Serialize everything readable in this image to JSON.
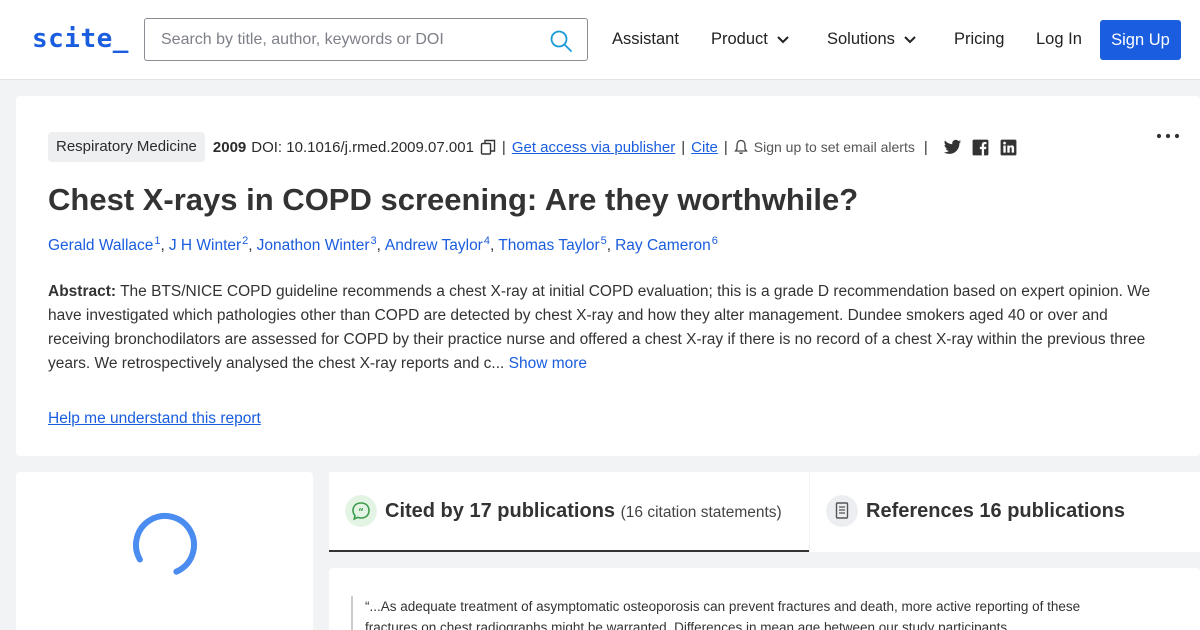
{
  "header": {
    "logo": "scite_",
    "search_placeholder": "Search by title, author, keywords or DOI",
    "nav": {
      "assistant": "Assistant",
      "product": "Product",
      "solutions": "Solutions",
      "pricing": "Pricing",
      "login": "Log In",
      "signup": "Sign Up"
    },
    "accent_color": "#1a5dde"
  },
  "paper": {
    "journal": "Respiratory Medicine",
    "year": "2009",
    "doi": "DOI: 10.1016/j.rmed.2009.07.001",
    "access_link": "Get access via publisher",
    "cite_link": "Cite",
    "alerts": "Sign up to set email alerts",
    "title": "Chest X-rays in COPD screening: Are they worthwhile?",
    "authors": [
      {
        "name": "Gerald Wallace",
        "sup": "1"
      },
      {
        "name": "J H Winter",
        "sup": "2"
      },
      {
        "name": "Jonathon Winter",
        "sup": "3"
      },
      {
        "name": "Andrew Taylor",
        "sup": "4"
      },
      {
        "name": "Thomas Taylor",
        "sup": "5"
      },
      {
        "name": "Ray Cameron",
        "sup": "6"
      }
    ],
    "abstract_label": "Abstract:",
    "abstract_text": "The BTS/NICE COPD guideline recommends a chest X-ray at initial COPD evaluation; this is a grade D recommendation based on expert opinion. We have investigated which pathologies other than COPD are detected by chest X-ray and how they alter management. Dundee smokers aged 40 or over and receiving bronchodilators are assessed for COPD by their practice nurse and offered a chest X-ray if there is no record of a chest X-ray within the previous three years. We retrospectively analysed the chest X-ray reports and c...",
    "show_more": "Show more",
    "help_link": "Help me understand this report"
  },
  "tabs": {
    "cited_by": "Cited by 17 publications",
    "cited_by_sub": "(16 citation statements)",
    "references": "References 16 publications"
  },
  "citation_quote": "“...As adequate treatment of asymptomatic osteoporosis can prevent fractures and death, more active reporting of these fractures on chest radiographs might be warranted. Differences in mean age between our study participants"
}
